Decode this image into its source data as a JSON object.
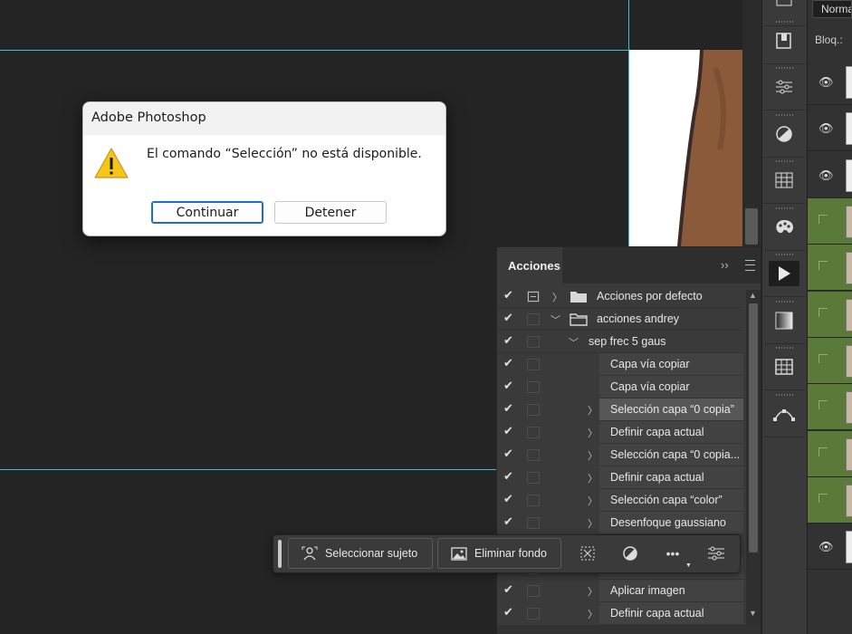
{
  "dialog": {
    "title": "Adobe Photoshop",
    "message": "El comando “Selección” no está disponible.",
    "continue_label": "Continuar",
    "stop_label": "Detener",
    "icon": "warning-icon"
  },
  "layers_panel": {
    "blend_mode": "Normal",
    "lock_label": "Bloq.:",
    "rows": [
      "visible",
      "visible",
      "visible",
      "green",
      "green",
      "green",
      "green",
      "green",
      "green",
      "green",
      "visible"
    ]
  },
  "actions_panel": {
    "tab_label": "Acciones",
    "rows": [
      {
        "label": "Acciones por defecto",
        "type": "set",
        "checked": true
      },
      {
        "label": "acciones andrey",
        "type": "set-open",
        "checked": true
      },
      {
        "label": "sep frec 5 gaus",
        "type": "action-open",
        "checked": true
      },
      {
        "label": "Capa vía copiar",
        "type": "step",
        "checked": true
      },
      {
        "label": "Capa vía copiar",
        "type": "step",
        "checked": true
      },
      {
        "label": "Selección capa “0 copia”",
        "type": "step-expand",
        "checked": true,
        "selected": true
      },
      {
        "label": "Definir capa actual",
        "type": "step-expand",
        "checked": true
      },
      {
        "label": "Selección capa “0 copia...",
        "type": "step-expand",
        "checked": true
      },
      {
        "label": "Definir capa actual",
        "type": "step-expand",
        "checked": true
      },
      {
        "label": "Selección capa “color”",
        "type": "step-expand",
        "checked": true
      },
      {
        "label": "Desenfoque gaussiano",
        "type": "step-expand",
        "checked": true
      },
      {
        "label": "",
        "type": "hidden",
        "checked": true
      },
      {
        "label": "Aplicar imagen",
        "type": "step-expand",
        "checked": true
      },
      {
        "label": "Definir capa actual",
        "type": "step-expand",
        "checked": true
      }
    ]
  },
  "taskbar": {
    "select_subject_label": "Seleccionar sujeto",
    "remove_background_label": "Eliminar fondo",
    "more_label": "•••"
  },
  "colors": {
    "guide": "#39c3d0",
    "dialog_primary_border": "#1e6fbf",
    "layer_group_green": "#5b7a3a"
  }
}
